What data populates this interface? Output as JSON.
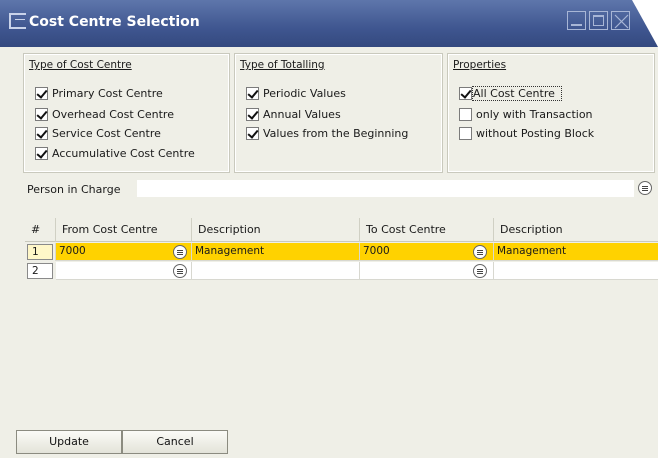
{
  "window": {
    "title": "Cost Centre Selection"
  },
  "type_of_cost_centre": {
    "title": "Type of Cost Centre",
    "options": [
      {
        "label": "Primary Cost Centre",
        "checked": true
      },
      {
        "label": "Overhead Cost Centre",
        "checked": true
      },
      {
        "label": "Service Cost Centre",
        "checked": true
      },
      {
        "label": "Accumulative Cost Centre",
        "checked": true
      }
    ]
  },
  "type_of_totalling": {
    "title": "Type of Totalling",
    "options": [
      {
        "label": "Periodic Values",
        "checked": true
      },
      {
        "label": "Annual Values",
        "checked": true
      },
      {
        "label": "Values from the Beginning",
        "checked": true
      }
    ]
  },
  "properties": {
    "title": "Properties",
    "options": [
      {
        "label": "All Cost Centre",
        "checked": true
      },
      {
        "label": "only with Transaction",
        "checked": false
      },
      {
        "label": "without Posting Block",
        "checked": false
      }
    ]
  },
  "person_in_charge": {
    "label": "Person in Charge",
    "value": ""
  },
  "grid": {
    "headers": [
      "#",
      "From Cost Centre",
      "Description",
      "To Cost Centre",
      "Description"
    ],
    "rows": [
      {
        "num": "1",
        "from": "7000",
        "from_desc": "Management",
        "to": "7000",
        "to_desc": "Management"
      },
      {
        "num": "2",
        "from": "",
        "from_desc": "",
        "to": "",
        "to_desc": ""
      }
    ]
  },
  "buttons": {
    "update": "Update",
    "cancel": "Cancel"
  },
  "colors": {
    "titlebar": "#3f5690",
    "selected_row": "#ffd200",
    "background": "#efefe7"
  }
}
